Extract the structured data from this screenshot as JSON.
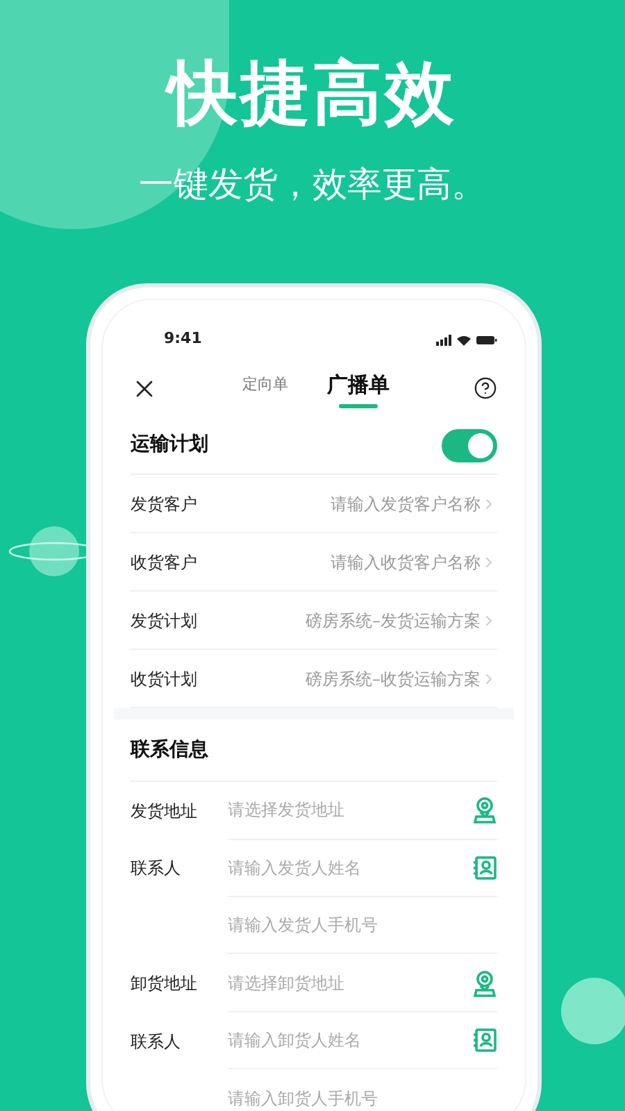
{
  "hero": {
    "title": "快捷高效",
    "subtitle": "一键发货，效率更高。"
  },
  "status_bar": {
    "time": "9:41"
  },
  "nav": {
    "tabs": [
      {
        "label": "定向单",
        "selected": false
      },
      {
        "label": "广播单",
        "selected": true
      }
    ]
  },
  "transport_plan": {
    "label": "运输计划",
    "on": true
  },
  "plan_rows": [
    {
      "label": "发货客户",
      "value": "请输入发货客户名称"
    },
    {
      "label": "收货客户",
      "value": "请输入收货客户名称"
    },
    {
      "label": "发货计划",
      "value": "磅房系统–发货运输方案"
    },
    {
      "label": "收货计划",
      "value": "磅房系统–收货运输方案"
    }
  ],
  "contact": {
    "title": "联系信息",
    "rows": [
      {
        "kind": "address",
        "label": "发货地址",
        "placeholder": "请选择发货地址"
      },
      {
        "kind": "person",
        "label": "联系人",
        "placeholder": "请输入发货人姓名"
      },
      {
        "kind": "phone",
        "placeholder": "请输入发货人手机号"
      },
      {
        "kind": "address",
        "label": "卸货地址",
        "placeholder": "请选择卸货地址"
      },
      {
        "kind": "person",
        "label": "联系人",
        "placeholder": "请输入卸货人姓名"
      },
      {
        "kind": "phone",
        "placeholder": "请输入卸货人手机号"
      }
    ]
  }
}
